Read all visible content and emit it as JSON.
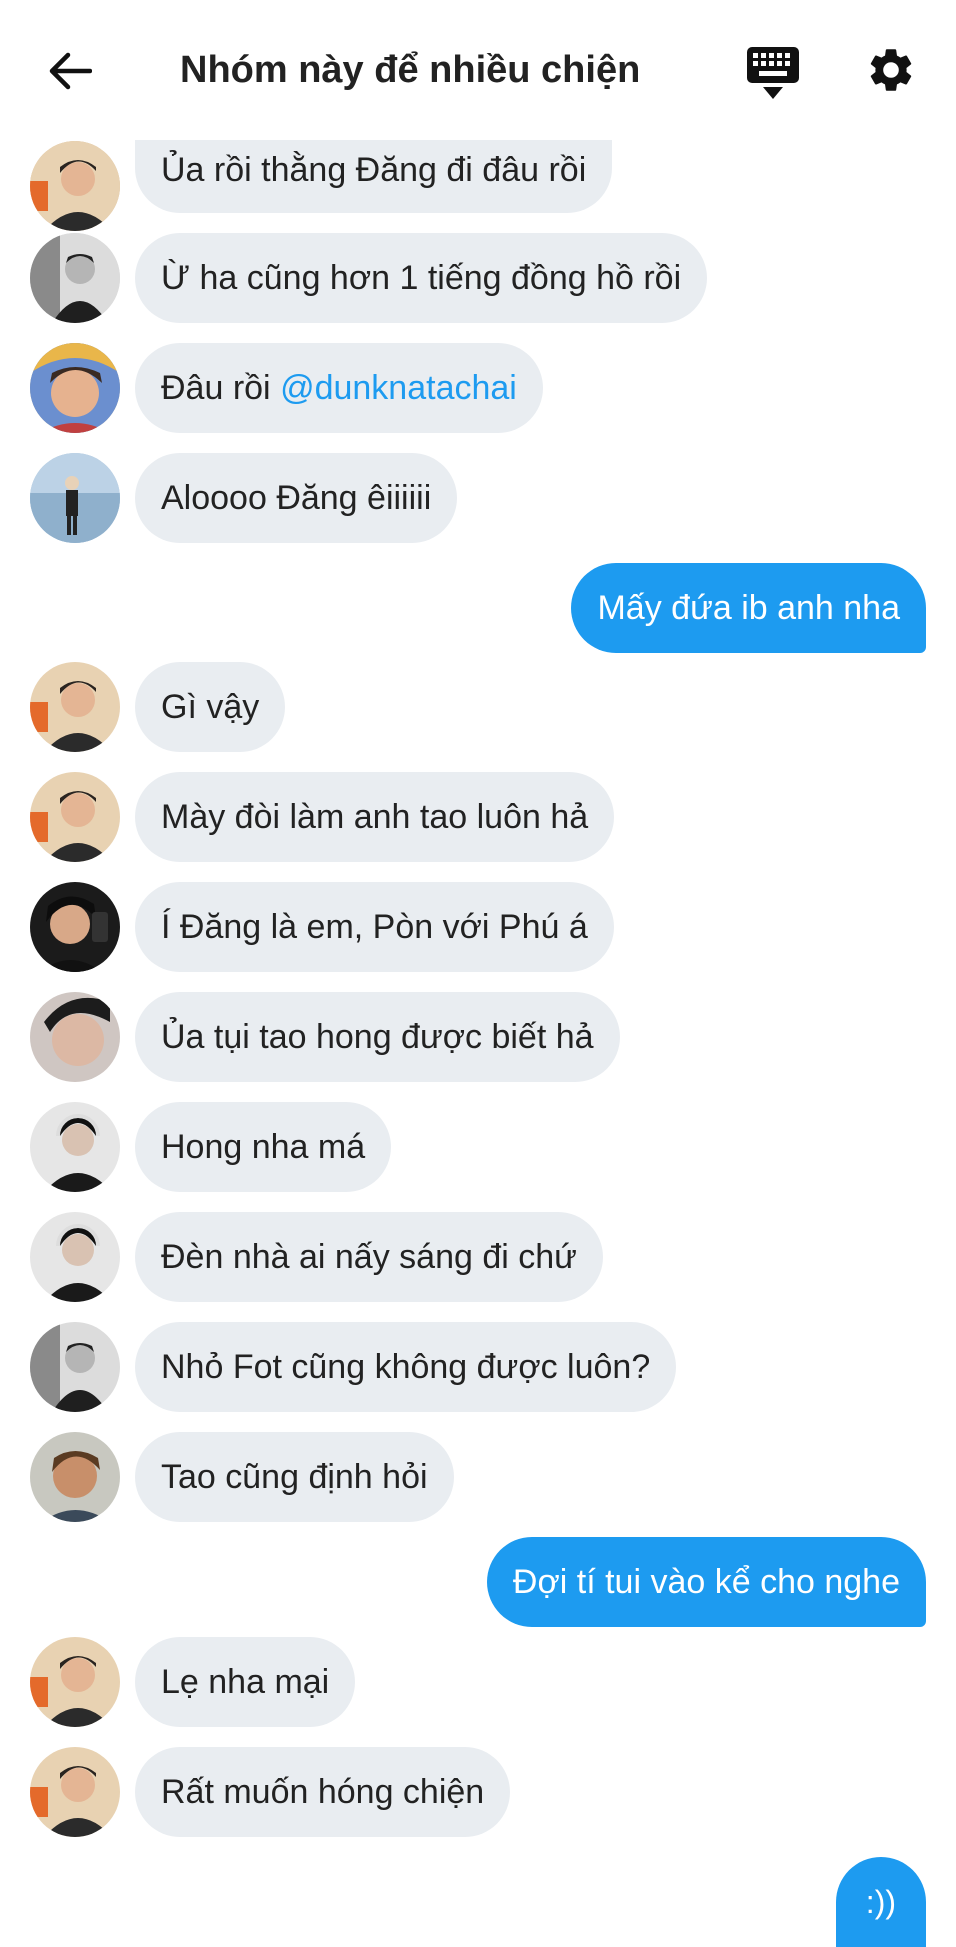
{
  "header": {
    "title": "Nhóm này để nhiều chiện",
    "back_icon": "arrow-left-icon",
    "keyboard_icon": "keyboard-hide-icon",
    "settings_icon": "gear-icon"
  },
  "colors": {
    "accent": "#1d9bf0",
    "bubble_other": "#e9edf1",
    "background": "#ffffff"
  },
  "messages": [
    {
      "from": "other",
      "text": "Ủa rồi thằng Đăng đi đâu rồi"
    },
    {
      "from": "other",
      "text": "Ừ ha cũng hơn 1 tiếng đồng hồ rồi"
    },
    {
      "from": "other",
      "text": "Đâu rồi ",
      "mention": "@dunknatachai"
    },
    {
      "from": "other",
      "text": "Aloooo Đăng êiiiiii"
    },
    {
      "from": "me",
      "text": "Mấy đứa ib anh nha"
    },
    {
      "from": "other",
      "text": "Gì vậy"
    },
    {
      "from": "other",
      "text": "Mày đòi làm anh tao luôn hả"
    },
    {
      "from": "other",
      "text": "Í Đăng là em, Pòn với Phú á"
    },
    {
      "from": "other",
      "text": "Ủa tụi tao hong được biết hả"
    },
    {
      "from": "other",
      "text": "Hong nha má"
    },
    {
      "from": "other",
      "text": "Đèn nhà ai nấy sáng đi chứ"
    },
    {
      "from": "other",
      "text": "Nhỏ Fot cũng không được luôn?"
    },
    {
      "from": "other",
      "text": "Tao cũng định hỏi"
    },
    {
      "from": "me",
      "text": "Đợi tí tui vào kể cho nghe"
    },
    {
      "from": "other",
      "text": "Lẹ nha mại"
    },
    {
      "from": "other",
      "text": "Rất muốn hóng chiện"
    },
    {
      "from": "me",
      "text": ":))"
    }
  ]
}
